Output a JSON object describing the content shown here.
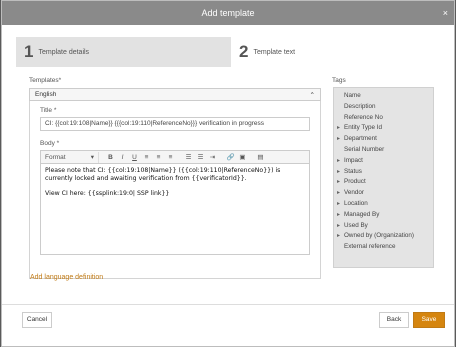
{
  "dialog": {
    "title": "Add template",
    "close_glyph": "×"
  },
  "steps": [
    {
      "number": "1",
      "label": "Template details"
    },
    {
      "number": "2",
      "label": "Template text"
    }
  ],
  "templates_label": "Templates*",
  "language": {
    "selected": "English",
    "toggle_glyph": "⌃"
  },
  "title_field": {
    "label": "Title *",
    "value": "CI: {{col:19:108|Name}} {{{col:19:110|ReferenceNo}}} verification in progress"
  },
  "body_field": {
    "label": "Body *",
    "format_label": "Format",
    "paragraphs": [
      "Please note that CI: {{col:19:108|Name}} ({{col:19:110|ReferenceNo}}) is currently locked and awaiting verification from {{verificatorId}}.",
      "View CI here: {{ssplink:19:0| SSP link}}"
    ]
  },
  "toolbar": {
    "bold": "B",
    "italic": "I",
    "underline": "U",
    "align_left": "≡",
    "align_center": "≡",
    "align_right": "≡",
    "bullet_list": "☰",
    "numbered_list": "☰",
    "indent": "⇥",
    "link": "🔗",
    "image": "▣",
    "source": "▤"
  },
  "add_language_label": "Add language definition",
  "tags": {
    "label": "Tags",
    "items": [
      {
        "label": "Name",
        "expandable": false
      },
      {
        "label": "Description",
        "expandable": false
      },
      {
        "label": "Reference No",
        "expandable": false
      },
      {
        "label": "Entity Type Id",
        "expandable": true
      },
      {
        "label": "Department",
        "expandable": true
      },
      {
        "label": "Serial Number",
        "expandable": false
      },
      {
        "label": "Impact",
        "expandable": true
      },
      {
        "label": "Status",
        "expandable": true
      },
      {
        "label": "Product",
        "expandable": true
      },
      {
        "label": "Vendor",
        "expandable": true
      },
      {
        "label": "Location",
        "expandable": true
      },
      {
        "label": "Managed By",
        "expandable": true
      },
      {
        "label": "Used By",
        "expandable": true
      },
      {
        "label": "Owned by (Organization)",
        "expandable": true
      },
      {
        "label": "External reference",
        "expandable": false
      }
    ]
  },
  "footer": {
    "cancel": "Cancel",
    "back": "Back",
    "save": "Save"
  },
  "colors": {
    "accent": "#d5850f",
    "titlebar": "#8a8a8a",
    "tags_bg": "#e4e4e4"
  }
}
